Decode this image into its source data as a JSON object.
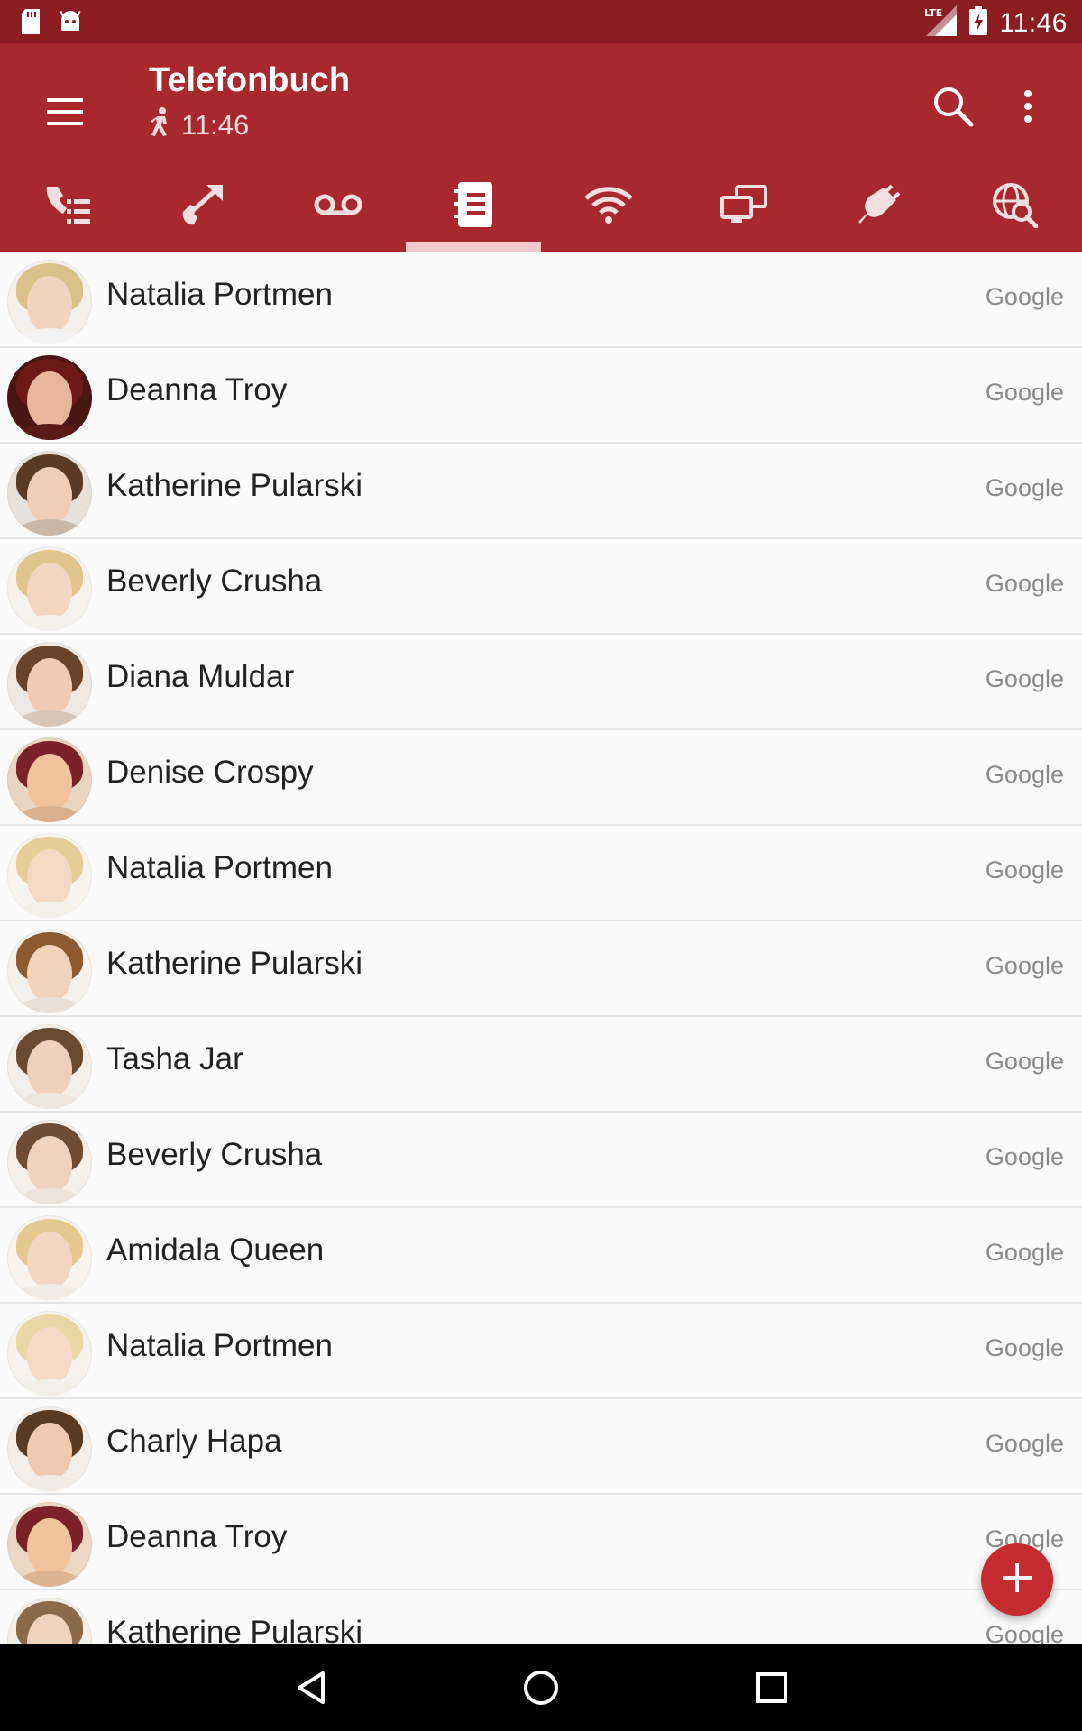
{
  "status_bar": {
    "time": "11:46",
    "network": "LTE",
    "icons": [
      "sd-card-icon",
      "android-debug-icon",
      "lte-signal-icon",
      "battery-charging-icon"
    ]
  },
  "app_bar": {
    "title": "Telefonbuch",
    "subtitle": "11:46",
    "icons": [
      "menu-icon",
      "walking-person-icon",
      "search-icon",
      "more-vert-icon"
    ],
    "color": "#a8282d"
  },
  "tabs": [
    {
      "icon": "call-list-icon",
      "active": false
    },
    {
      "icon": "call-forward-icon",
      "active": false
    },
    {
      "icon": "voicemail-icon",
      "active": false
    },
    {
      "icon": "phonebook-icon",
      "active": true
    },
    {
      "icon": "wifi-icon",
      "active": false
    },
    {
      "icon": "network-devices-icon",
      "active": false
    },
    {
      "icon": "smart-plug-icon",
      "active": false
    },
    {
      "icon": "web-search-icon",
      "active": false
    }
  ],
  "contacts": [
    {
      "name": "Natalia Portmen",
      "account": "Google"
    },
    {
      "name": "Deanna Troy",
      "account": "Google"
    },
    {
      "name": "Katherine Pularski",
      "account": "Google"
    },
    {
      "name": "Beverly Crusha",
      "account": "Google"
    },
    {
      "name": "Diana Muldar",
      "account": "Google"
    },
    {
      "name": "Denise Crospy",
      "account": "Google"
    },
    {
      "name": "Natalia Portmen",
      "account": "Google"
    },
    {
      "name": "Katherine Pularski",
      "account": "Google"
    },
    {
      "name": "Tasha Jar",
      "account": "Google"
    },
    {
      "name": "Beverly Crusha",
      "account": "Google"
    },
    {
      "name": "Amidala Queen",
      "account": "Google"
    },
    {
      "name": "Natalia Portmen",
      "account": "Google"
    },
    {
      "name": "Charly Hapa",
      "account": "Google"
    },
    {
      "name": "Deanna Troy",
      "account": "Google"
    },
    {
      "name": "Katherine Pularski",
      "account": "Google"
    }
  ],
  "fab": {
    "icon": "add-icon",
    "color": "#c62b30"
  },
  "nav_bar": {
    "icons": [
      "back-icon",
      "home-icon",
      "recents-icon"
    ]
  }
}
